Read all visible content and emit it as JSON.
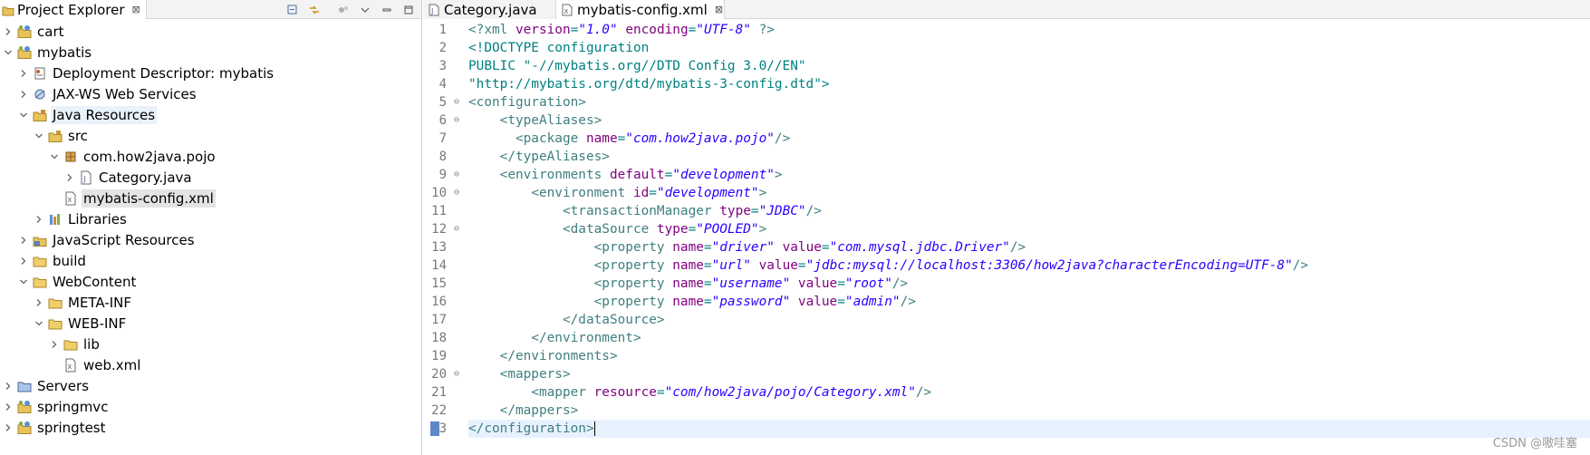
{
  "explorer": {
    "tab_label": "Project Explorer",
    "tab_close": "⊠",
    "tree": [
      {
        "depth": 0,
        "expanded": false,
        "icon": "project-icon",
        "label": "cart"
      },
      {
        "depth": 0,
        "expanded": true,
        "icon": "project-icon",
        "label": "mybatis"
      },
      {
        "depth": 1,
        "expanded": false,
        "icon": "deployment-descriptor-icon",
        "label": "Deployment Descriptor: mybatis"
      },
      {
        "depth": 1,
        "expanded": false,
        "icon": "web-services-icon",
        "label": "JAX-WS Web Services"
      },
      {
        "depth": 1,
        "expanded": true,
        "icon": "java-resources-icon",
        "label": "Java Resources",
        "state": "hover"
      },
      {
        "depth": 2,
        "expanded": true,
        "icon": "source-folder-icon",
        "label": "src"
      },
      {
        "depth": 3,
        "expanded": true,
        "icon": "package-icon",
        "label": "com.how2java.pojo"
      },
      {
        "depth": 4,
        "expanded": false,
        "icon": "java-file-icon",
        "label": "Category.java"
      },
      {
        "depth": 3,
        "expanded": null,
        "icon": "xml-file-icon",
        "label": "mybatis-config.xml",
        "state": "selected"
      },
      {
        "depth": 2,
        "expanded": false,
        "icon": "libraries-icon",
        "label": "Libraries"
      },
      {
        "depth": 1,
        "expanded": false,
        "icon": "javascript-resources-icon",
        "label": "JavaScript Resources"
      },
      {
        "depth": 1,
        "expanded": false,
        "icon": "folder-icon",
        "label": "build"
      },
      {
        "depth": 1,
        "expanded": true,
        "icon": "folder-icon",
        "label": "WebContent"
      },
      {
        "depth": 2,
        "expanded": false,
        "icon": "folder-icon",
        "label": "META-INF"
      },
      {
        "depth": 2,
        "expanded": true,
        "icon": "folder-icon",
        "label": "WEB-INF"
      },
      {
        "depth": 3,
        "expanded": false,
        "icon": "folder-icon",
        "label": "lib"
      },
      {
        "depth": 3,
        "expanded": null,
        "icon": "xml-file-icon",
        "label": "web.xml"
      },
      {
        "depth": 0,
        "expanded": false,
        "icon": "servers-folder-icon",
        "label": "Servers"
      },
      {
        "depth": 0,
        "expanded": false,
        "icon": "project-icon",
        "label": "springmvc"
      },
      {
        "depth": 0,
        "expanded": false,
        "icon": "project-icon",
        "label": "springtest"
      }
    ]
  },
  "editor": {
    "tabs": [
      {
        "label": "Category.java",
        "icon": "java-file-icon",
        "active": false
      },
      {
        "label": "mybatis-config.xml",
        "icon": "xml-file-icon",
        "active": true,
        "close": "⊠"
      }
    ],
    "current_line": 23,
    "lines": [
      {
        "n": "1",
        "fold": "",
        "segs": [
          [
            "t",
            "<?xml "
          ],
          [
            "a",
            "version"
          ],
          [
            "p",
            "="
          ],
          [
            "v",
            "\"1.0\""
          ],
          [
            "p",
            " "
          ],
          [
            "a",
            "encoding"
          ],
          [
            "p",
            "="
          ],
          [
            "v",
            "\"UTF-8\""
          ],
          [
            "t",
            " ?>"
          ]
        ]
      },
      {
        "n": "2",
        "fold": "",
        "segs": [
          [
            "p",
            "<!DOCTYPE configuration"
          ]
        ]
      },
      {
        "n": "3",
        "fold": "",
        "segs": [
          [
            "p",
            "PUBLIC \"-//mybatis.org//DTD Config 3.0//EN\""
          ]
        ]
      },
      {
        "n": "4",
        "fold": "",
        "segs": [
          [
            "p",
            "\"http://mybatis.org/dtd/mybatis-3-config.dtd\">"
          ]
        ]
      },
      {
        "n": "5",
        "fold": "⊖",
        "segs": [
          [
            "t",
            "<configuration>"
          ]
        ]
      },
      {
        "n": "6",
        "fold": "⊖",
        "segs": [
          [
            "p",
            "    "
          ],
          [
            "t",
            "<typeAliases>"
          ]
        ]
      },
      {
        "n": "7",
        "fold": "",
        "segs": [
          [
            "p",
            "      "
          ],
          [
            "t",
            "<package "
          ],
          [
            "a",
            "name"
          ],
          [
            "p",
            "="
          ],
          [
            "v",
            "\"com.how2java.pojo\""
          ],
          [
            "t",
            "/>"
          ]
        ]
      },
      {
        "n": "8",
        "fold": "",
        "segs": [
          [
            "p",
            "    "
          ],
          [
            "t",
            "</typeAliases>"
          ]
        ]
      },
      {
        "n": "9",
        "fold": "⊖",
        "segs": [
          [
            "p",
            "    "
          ],
          [
            "t",
            "<environments "
          ],
          [
            "a",
            "default"
          ],
          [
            "p",
            "="
          ],
          [
            "v",
            "\"development\""
          ],
          [
            "t",
            ">"
          ]
        ]
      },
      {
        "n": "10",
        "fold": "⊖",
        "segs": [
          [
            "p",
            "        "
          ],
          [
            "t",
            "<environment "
          ],
          [
            "a",
            "id"
          ],
          [
            "p",
            "="
          ],
          [
            "v",
            "\"development\""
          ],
          [
            "t",
            ">"
          ]
        ]
      },
      {
        "n": "11",
        "fold": "",
        "segs": [
          [
            "p",
            "            "
          ],
          [
            "t",
            "<transactionManager "
          ],
          [
            "a",
            "type"
          ],
          [
            "p",
            "="
          ],
          [
            "v",
            "\"JDBC\""
          ],
          [
            "t",
            "/>"
          ]
        ]
      },
      {
        "n": "12",
        "fold": "⊖",
        "segs": [
          [
            "p",
            "            "
          ],
          [
            "t",
            "<dataSource "
          ],
          [
            "a",
            "type"
          ],
          [
            "p",
            "="
          ],
          [
            "v",
            "\"POOLED\""
          ],
          [
            "t",
            ">"
          ]
        ]
      },
      {
        "n": "13",
        "fold": "",
        "segs": [
          [
            "p",
            "                "
          ],
          [
            "t",
            "<property "
          ],
          [
            "a",
            "name"
          ],
          [
            "p",
            "="
          ],
          [
            "v",
            "\"driver\""
          ],
          [
            "p",
            " "
          ],
          [
            "a",
            "value"
          ],
          [
            "p",
            "="
          ],
          [
            "v",
            "\"com.mysql.jdbc.Driver\""
          ],
          [
            "t",
            "/>"
          ]
        ]
      },
      {
        "n": "14",
        "fold": "",
        "segs": [
          [
            "p",
            "                "
          ],
          [
            "t",
            "<property "
          ],
          [
            "a",
            "name"
          ],
          [
            "p",
            "="
          ],
          [
            "v",
            "\"url\""
          ],
          [
            "p",
            " "
          ],
          [
            "a",
            "value"
          ],
          [
            "p",
            "="
          ],
          [
            "v",
            "\"jdbc:mysql://localhost:3306/how2java?characterEncoding=UTF-8\""
          ],
          [
            "t",
            "/>"
          ]
        ]
      },
      {
        "n": "15",
        "fold": "",
        "segs": [
          [
            "p",
            "                "
          ],
          [
            "t",
            "<property "
          ],
          [
            "a",
            "name"
          ],
          [
            "p",
            "="
          ],
          [
            "v",
            "\"username\""
          ],
          [
            "p",
            " "
          ],
          [
            "a",
            "value"
          ],
          [
            "p",
            "="
          ],
          [
            "v",
            "\"root\""
          ],
          [
            "t",
            "/>"
          ]
        ]
      },
      {
        "n": "16",
        "fold": "",
        "segs": [
          [
            "p",
            "                "
          ],
          [
            "t",
            "<property "
          ],
          [
            "a",
            "name"
          ],
          [
            "p",
            "="
          ],
          [
            "v",
            "\"password\""
          ],
          [
            "p",
            " "
          ],
          [
            "a",
            "value"
          ],
          [
            "p",
            "="
          ],
          [
            "v",
            "\"admin\""
          ],
          [
            "t",
            "/>"
          ]
        ]
      },
      {
        "n": "17",
        "fold": "",
        "segs": [
          [
            "p",
            "            "
          ],
          [
            "t",
            "</dataSource>"
          ]
        ]
      },
      {
        "n": "18",
        "fold": "",
        "segs": [
          [
            "p",
            "        "
          ],
          [
            "t",
            "</environment>"
          ]
        ]
      },
      {
        "n": "19",
        "fold": "",
        "segs": [
          [
            "p",
            "    "
          ],
          [
            "t",
            "</environments>"
          ]
        ]
      },
      {
        "n": "20",
        "fold": "⊖",
        "segs": [
          [
            "p",
            "    "
          ],
          [
            "t",
            "<mappers>"
          ]
        ]
      },
      {
        "n": "21",
        "fold": "",
        "segs": [
          [
            "p",
            "        "
          ],
          [
            "t",
            "<mapper "
          ],
          [
            "a",
            "resource"
          ],
          [
            "p",
            "="
          ],
          [
            "v",
            "\"com/how2java/pojo/Category.xml\""
          ],
          [
            "t",
            "/>"
          ]
        ]
      },
      {
        "n": "22",
        "fold": "",
        "segs": [
          [
            "p",
            "    "
          ],
          [
            "t",
            "</mappers>"
          ]
        ]
      },
      {
        "n": "23",
        "fold": "",
        "segs": [
          [
            "t",
            "</configuration>"
          ]
        ]
      }
    ]
  },
  "watermark": "CSDN @嗷哇塞",
  "colors": {
    "tag": "#3f7f7f",
    "attribute": "#7f007f",
    "value": "#2a00ff",
    "current_line": "#e8f2fe"
  }
}
